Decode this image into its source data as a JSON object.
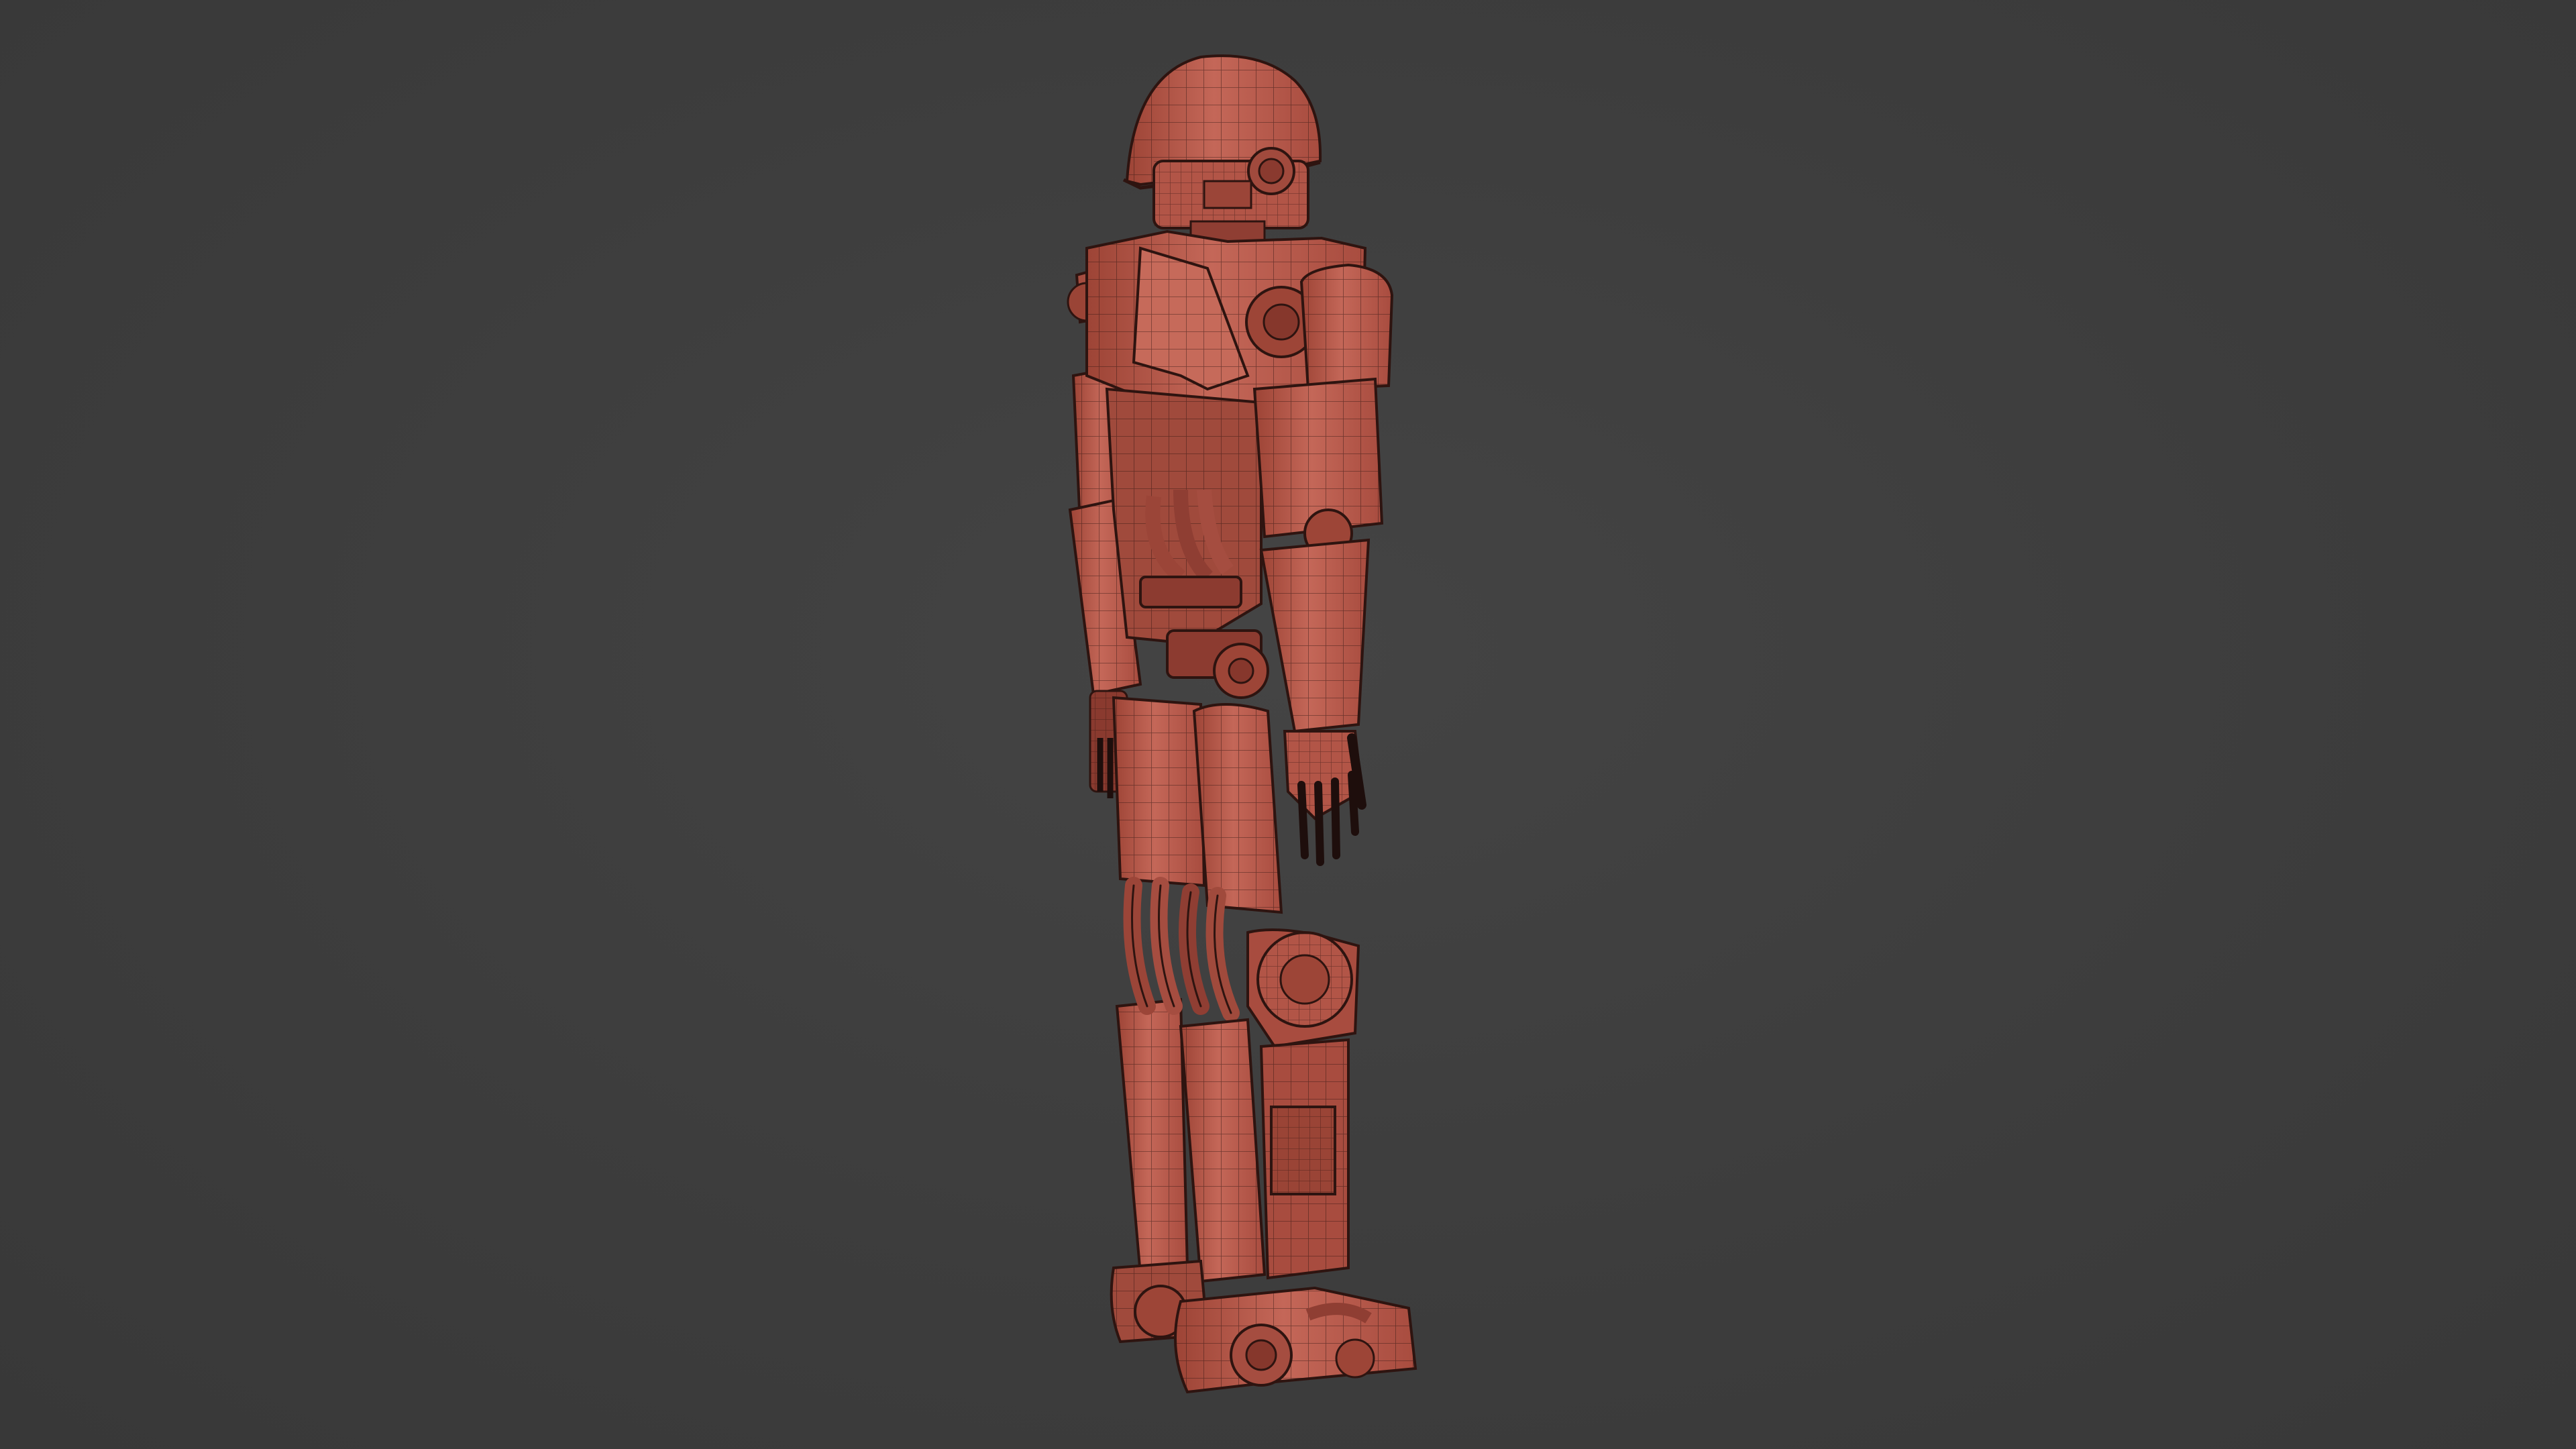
{
  "viewport": {
    "background": "#3d3d3d",
    "model_name": "robot-soldier-wireframe",
    "shading": "solid-with-wireframe",
    "model_color": "#b85a4c",
    "wire_color": "#2e1410",
    "shadow_color": "#7a3228",
    "highlight_color": "#d98070"
  }
}
